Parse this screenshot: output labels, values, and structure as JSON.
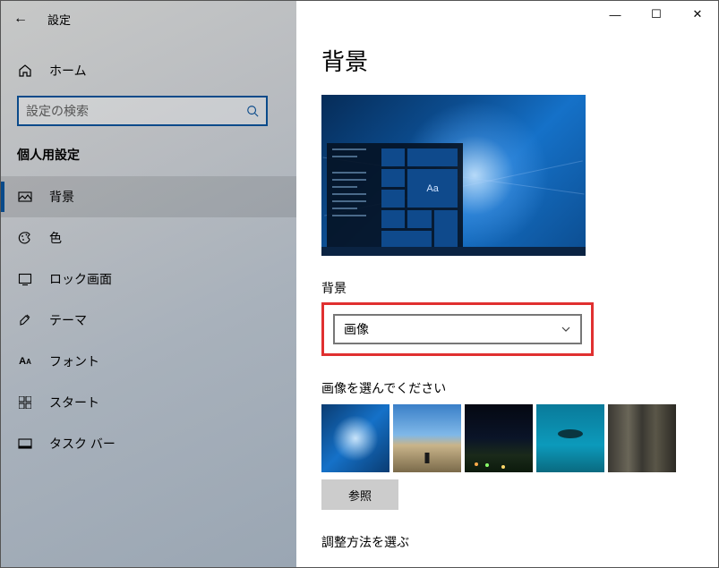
{
  "header": {
    "back_aria": "戻る",
    "title": "設定"
  },
  "home": {
    "label": "ホーム"
  },
  "search": {
    "placeholder": "設定の検索"
  },
  "category": "個人用設定",
  "sidebar": {
    "items": [
      {
        "icon": "image-icon",
        "label": "背景",
        "active": true
      },
      {
        "icon": "palette-icon",
        "label": "色"
      },
      {
        "icon": "lock-screen-icon",
        "label": "ロック画面"
      },
      {
        "icon": "theme-icon",
        "label": "テーマ"
      },
      {
        "icon": "font-icon",
        "label": "フォント"
      },
      {
        "icon": "start-icon",
        "label": "スタート"
      },
      {
        "icon": "taskbar-icon",
        "label": "タスク バー"
      }
    ]
  },
  "titlebar": {
    "min": "—",
    "max": "☐",
    "close": "✕"
  },
  "main": {
    "page_title": "背景",
    "preview_tile_text": "Aa",
    "bg_label": "背景",
    "dropdown_value": "画像",
    "choose_label": "画像を選んでください",
    "browse_label": "参照",
    "fit_label": "調整方法を選ぶ"
  }
}
